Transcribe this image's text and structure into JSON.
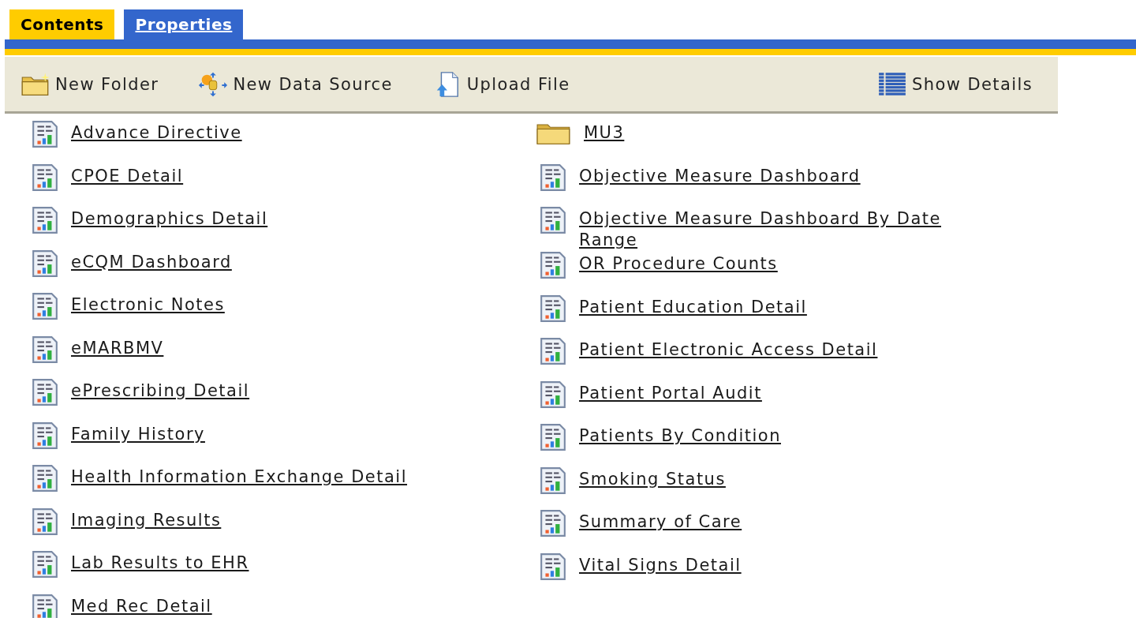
{
  "tabs": [
    {
      "label": "Contents",
      "selected": true
    },
    {
      "label": "Properties",
      "selected": false
    }
  ],
  "toolbar": [
    {
      "kind": "new-folder",
      "label": "New Folder"
    },
    {
      "kind": "new-data-source",
      "label": "New Data Source"
    },
    {
      "kind": "upload",
      "label": "Upload File"
    },
    {
      "kind": "details",
      "label": "Show Details"
    }
  ],
  "columns": [
    [
      {
        "kind": "report",
        "label": "Advance Directive"
      },
      {
        "kind": "report",
        "label": "CPOE Detail"
      },
      {
        "kind": "report",
        "label": "Demographics Detail"
      },
      {
        "kind": "report",
        "label": "eCQM Dashboard"
      },
      {
        "kind": "report",
        "label": "Electronic Notes"
      },
      {
        "kind": "report",
        "label": "eMARBMV"
      },
      {
        "kind": "report",
        "label": "ePrescribing Detail"
      },
      {
        "kind": "report",
        "label": "Family History"
      },
      {
        "kind": "report",
        "label": "Health Information Exchange Detail"
      },
      {
        "kind": "report",
        "label": "Imaging Results"
      },
      {
        "kind": "report",
        "label": "Lab Results to EHR"
      },
      {
        "kind": "report",
        "label": "Med Rec Detail"
      }
    ],
    [
      {
        "kind": "folder",
        "label": "MU3"
      },
      {
        "kind": "report",
        "label": "Objective Measure Dashboard"
      },
      {
        "kind": "report",
        "label": "Objective Measure Dashboard By Date Range"
      },
      {
        "kind": "report",
        "label": "OR Procedure Counts"
      },
      {
        "kind": "report",
        "label": "Patient Education Detail"
      },
      {
        "kind": "report",
        "label": "Patient Electronic Access Detail"
      },
      {
        "kind": "report",
        "label": "Patient Portal Audit"
      },
      {
        "kind": "report",
        "label": "Patients By Condition"
      },
      {
        "kind": "report",
        "label": "Smoking Status"
      },
      {
        "kind": "report",
        "label": "Summary of Care"
      },
      {
        "kind": "report",
        "label": "Vital Signs Detail"
      }
    ]
  ]
}
